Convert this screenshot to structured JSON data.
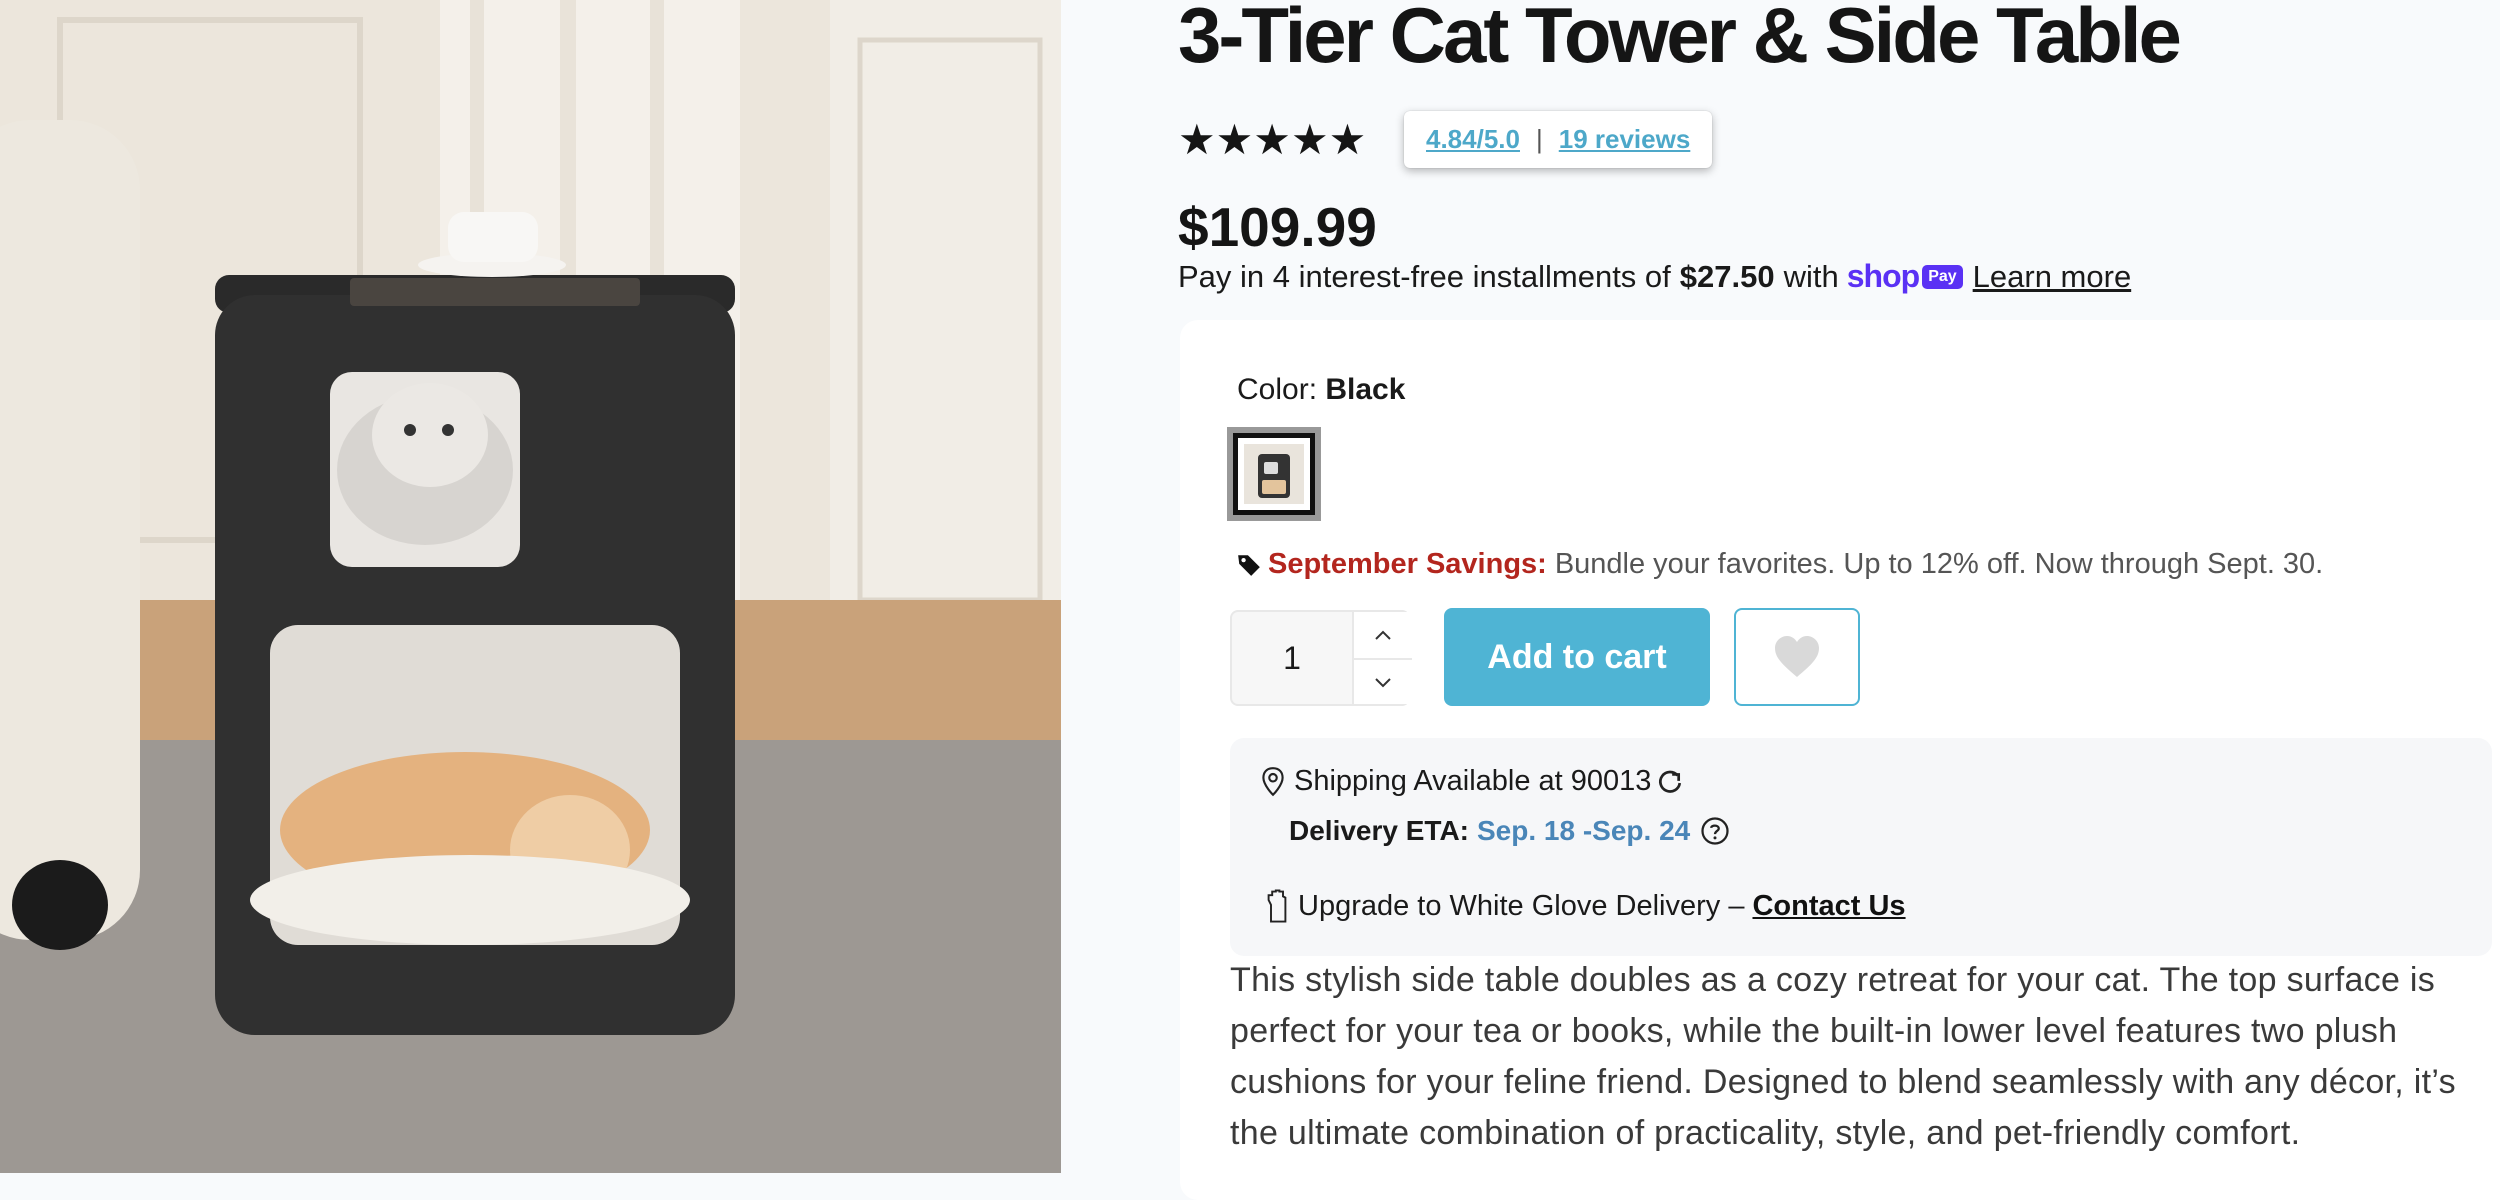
{
  "product": {
    "title": "3-Tier Cat Tower & Side Table",
    "stars": "★★★★★",
    "rating": "4.84/5.0",
    "rating_separator": "|",
    "reviews": "19 reviews",
    "price": "$109.99"
  },
  "installments": {
    "prefix": "Pay in 4 interest-free installments of",
    "amount": "$27.50",
    "with": "with",
    "shop_word": "shop",
    "pay_badge": "Pay",
    "learn_more": "Learn more"
  },
  "variant": {
    "color_label": "Color:",
    "color_value": "Black"
  },
  "promo": {
    "label": "September Savings:",
    "text": "Bundle your favorites. Up to 12% off. Now through Sept. 30."
  },
  "cart": {
    "quantity": "1",
    "add_to_cart": "Add to cart"
  },
  "shipping": {
    "available_text": "Shipping Available at 90013",
    "eta_label": "Delivery ETA:",
    "eta_dates": "Sep. 18 -Sep. 24",
    "upgrade_text": "Upgrade to White Glove Delivery –",
    "contact_link": "Contact Us"
  },
  "description": "This stylish side table doubles as a cozy retreat for your cat. The top surface is perfect for your tea or books, while the built-in lower level features two plush cushions for your feline friend. Designed to blend seamlessly with any décor, it’s the ultimate combination of practicality, style, and pet-friendly comfort.",
  "colors": {
    "accent": "#4fb4d4",
    "link": "#4da8c9",
    "savings_red": "#b3261e",
    "eta_blue": "#4a86b8",
    "shop_purple": "#5a31f4"
  }
}
